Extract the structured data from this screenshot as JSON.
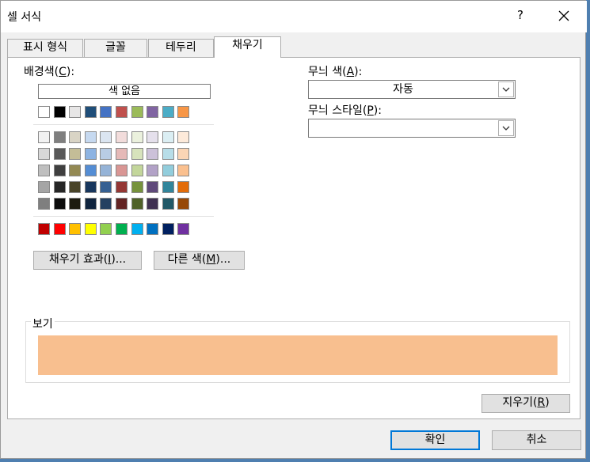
{
  "window": {
    "title": "셀 서식",
    "help": "?"
  },
  "tabs": [
    {
      "label": "표시 형식",
      "active": false
    },
    {
      "label": "글꼴",
      "active": false
    },
    {
      "label": "테두리",
      "active": false
    },
    {
      "label": "채우기",
      "active": true
    }
  ],
  "fill": {
    "background_label_pre": "배경색(",
    "background_label_key": "C",
    "background_label_post": "):",
    "no_color": "색 없음",
    "colors": {
      "theme_row": [
        "#ffffff",
        "#000000",
        "#e7e6e6",
        "#1f4e79",
        "#4472c4",
        "#c0504d",
        "#9bbb59",
        "#8064a2",
        "#4bacc6",
        "#f79646"
      ],
      "tint_rows": [
        [
          "#f2f2f2",
          "#7f7f7f",
          "#d9d4c5",
          "#c6d9f0",
          "#dbe5f1",
          "#f2dcdb",
          "#ebf1dd",
          "#e5e0ec",
          "#dbeef3",
          "#fdeada"
        ],
        [
          "#d8d8d8",
          "#595959",
          "#c4bd97",
          "#8db3e2",
          "#b8cce4",
          "#e5b9b7",
          "#d7e3bc",
          "#ccc1d9",
          "#b7dde8",
          "#fbd5b5"
        ],
        [
          "#bfbfbf",
          "#3f3f3f",
          "#938953",
          "#548dd4",
          "#95b3d7",
          "#d99694",
          "#c3d69b",
          "#b2a2c7",
          "#92cddc",
          "#fac08f"
        ],
        [
          "#a5a5a5",
          "#262626",
          "#494429",
          "#17365d",
          "#366092",
          "#953734",
          "#76923c",
          "#5f497a",
          "#31859b",
          "#e36c09"
        ],
        [
          "#7f7f7f",
          "#0c0c0c",
          "#1d1b10",
          "#0f243e",
          "#244061",
          "#632423",
          "#4f6128",
          "#3f3151",
          "#205867",
          "#974806"
        ]
      ],
      "standard_row": [
        "#c00000",
        "#ff0000",
        "#ffc000",
        "#ffff00",
        "#92d050",
        "#00b050",
        "#00b0f0",
        "#0070c0",
        "#002060",
        "#7030a0"
      ],
      "selected": "#fac08f"
    },
    "effects_button_pre": "채우기 효과(",
    "effects_button_key": "I",
    "effects_button_post": ")...",
    "more_colors_pre": "다른 색(",
    "more_colors_key": "M",
    "more_colors_post": ")...",
    "pattern_color_pre": "무늬 색(",
    "pattern_color_key": "A",
    "pattern_color_post": "):",
    "pattern_color_value": "자동",
    "pattern_style_pre": "무늬 스타일(",
    "pattern_style_key": "P",
    "pattern_style_post": "):",
    "pattern_style_value": "",
    "preview_label": "보기",
    "preview_color": "#f8bf8f",
    "clear_pre": "지우기(",
    "clear_key": "R",
    "clear_post": ")"
  },
  "footer": {
    "ok": "확인",
    "cancel": "취소"
  }
}
